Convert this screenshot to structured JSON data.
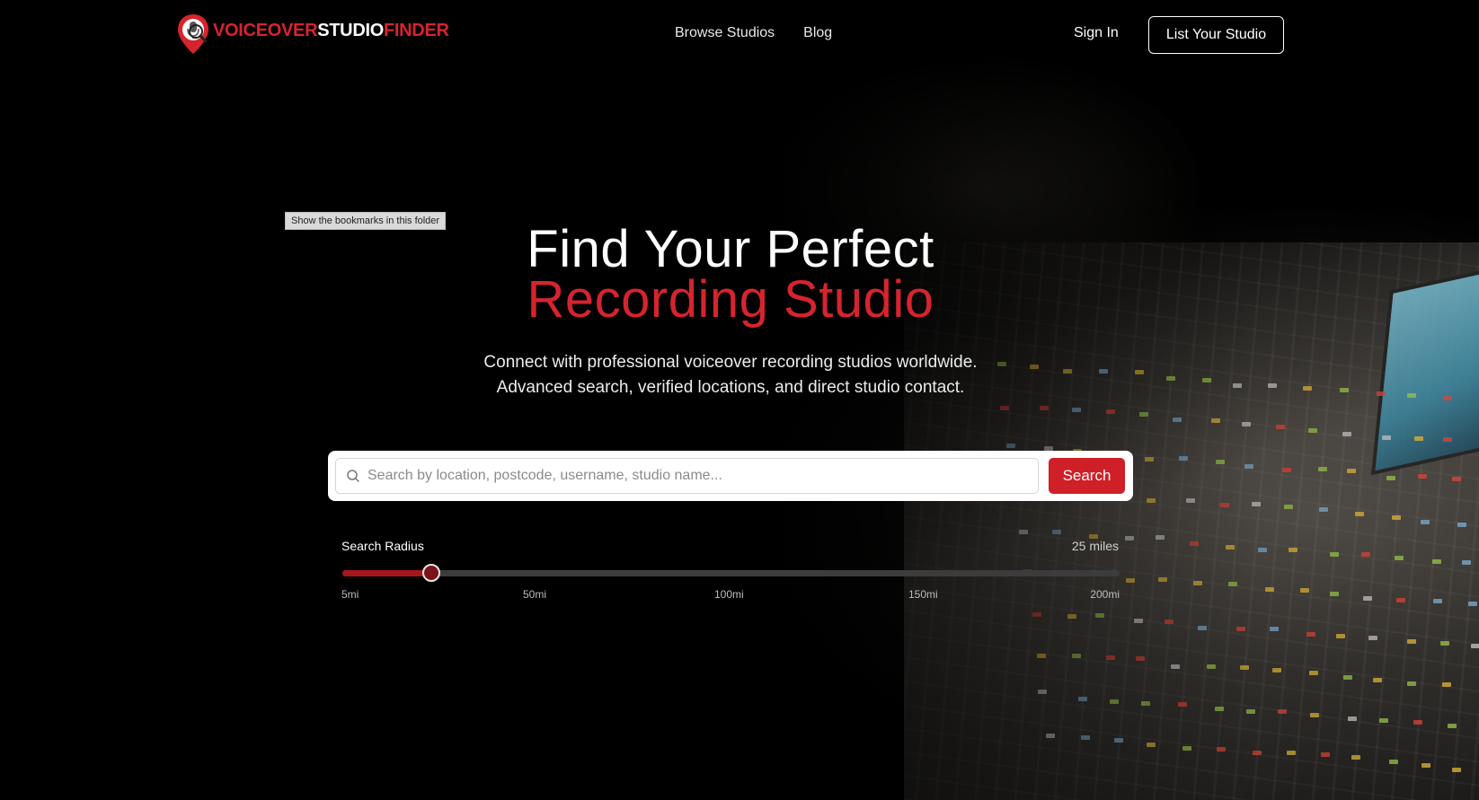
{
  "brand": {
    "logo_part1": "VOICEOVER",
    "logo_part2": "STUDIO",
    "logo_part3": "FINDER",
    "accent_color": "#d6242d"
  },
  "nav": {
    "links": [
      "Browse Studios",
      "Blog"
    ],
    "sign_in": "Sign In",
    "list_studio": "List Your Studio"
  },
  "tooltip": "Show the bookmarks in this folder",
  "hero": {
    "title_line1": "Find Your Perfect",
    "title_line2": "Recording Studio",
    "subtitle_line1": "Connect with professional voiceover recording studios worldwide.",
    "subtitle_line2": "Advanced search, verified locations, and direct studio contact."
  },
  "search": {
    "placeholder": "Search by location, postcode, username, studio name...",
    "value": "",
    "button": "Search",
    "icon": "search-icon"
  },
  "radius": {
    "label": "Search Radius",
    "value_text": "25 miles",
    "value": 25,
    "min": 5,
    "max": 200,
    "ticks": [
      "5mi",
      "50mi",
      "100mi",
      "150mi",
      "200mi"
    ]
  }
}
